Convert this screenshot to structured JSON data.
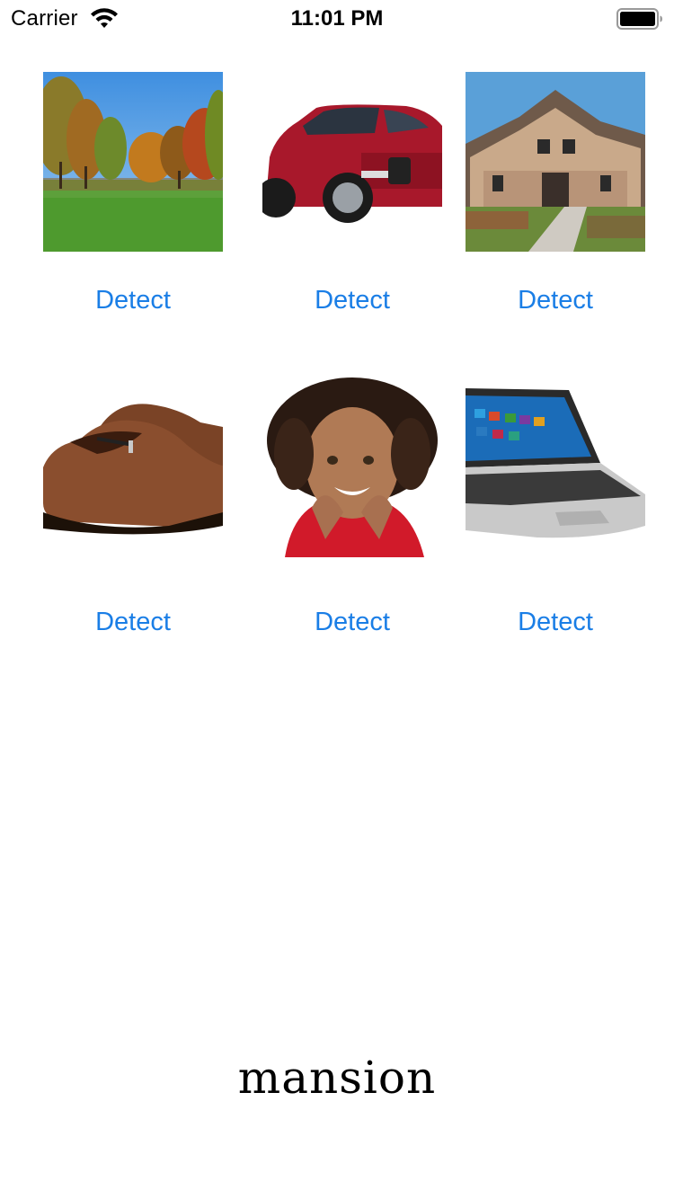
{
  "status_bar": {
    "carrier": "Carrier",
    "time": "11:01 PM",
    "icons": [
      "wifi-icon",
      "battery-icon"
    ]
  },
  "grid": {
    "items": [
      {
        "image": "park-trees-image",
        "button_label": "Detect"
      },
      {
        "image": "red-suv-image",
        "button_label": "Detect"
      },
      {
        "image": "house-image",
        "button_label": "Detect"
      },
      {
        "image": "brown-shoes-image",
        "button_label": "Detect"
      },
      {
        "image": "girl-portrait-image",
        "button_label": "Detect"
      },
      {
        "image": "laptop-image",
        "button_label": "Detect"
      }
    ]
  },
  "result": {
    "label": "mansion"
  },
  "colors": {
    "accent": "#1a7ee6",
    "background": "#ffffff",
    "text": "#000000"
  }
}
